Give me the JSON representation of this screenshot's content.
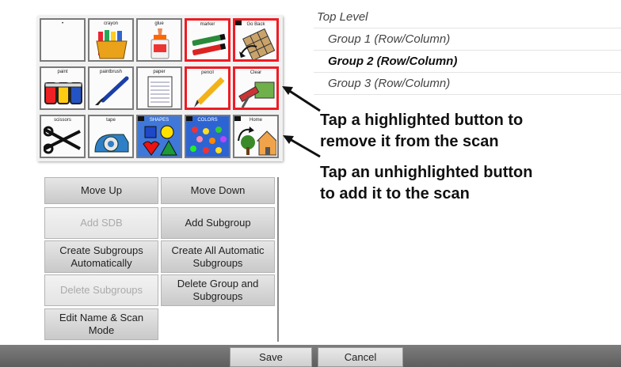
{
  "grid": {
    "cells": [
      {
        "label": "•",
        "icon": "dot-icon"
      },
      {
        "label": "crayon",
        "icon": "crayon-icon"
      },
      {
        "label": "glue",
        "icon": "glue-icon"
      },
      {
        "label": "marker",
        "icon": "marker-icon",
        "highlighted": true
      },
      {
        "label": "Go Back",
        "icon": "go-back-icon",
        "highlighted": true
      },
      {
        "label": "paint",
        "icon": "paint-icon"
      },
      {
        "label": "paintbrush",
        "icon": "paintbrush-icon"
      },
      {
        "label": "paper",
        "icon": "paper-icon"
      },
      {
        "label": "pencil",
        "icon": "pencil-icon",
        "highlighted": true
      },
      {
        "label": "Clear",
        "icon": "clear-icon",
        "highlighted": true
      },
      {
        "label": "scissors",
        "icon": "scissors-icon"
      },
      {
        "label": "tape",
        "icon": "tape-icon"
      },
      {
        "label": "SHAPES",
        "icon": "shapes-icon"
      },
      {
        "label": "COLORS",
        "icon": "colors-icon"
      },
      {
        "label": "Home",
        "icon": "home-icon"
      }
    ],
    "highlight_color": "#ee1c24"
  },
  "tree": {
    "top": "Top Level",
    "groups": [
      "Group 1 (Row/Column)",
      "Group 2 (Row/Column)",
      "Group 3 (Row/Column)"
    ],
    "selected_index": 1
  },
  "annotations": {
    "line1a": "Tap a highlighted button to",
    "line1b": "remove it from the scan",
    "line2a": "Tap an unhighlighted button",
    "line2b": "to add it to the scan"
  },
  "buttons": {
    "move_up": "Move Up",
    "move_down": "Move Down",
    "add_sdb": "Add SDB",
    "add_subgroup": "Add Subgroup",
    "create_subgroups_auto": "Create Subgroups\nAutomatically",
    "create_all_auto": "Create All Automatic\nSubgroups",
    "delete_subgroups": "Delete Subgroups",
    "delete_group_and_subgroups": "Delete Group and\nSubgroups",
    "edit_name_scan_mode": "Edit Name & Scan\nMode"
  },
  "footer": {
    "save": "Save",
    "cancel": "Cancel"
  }
}
